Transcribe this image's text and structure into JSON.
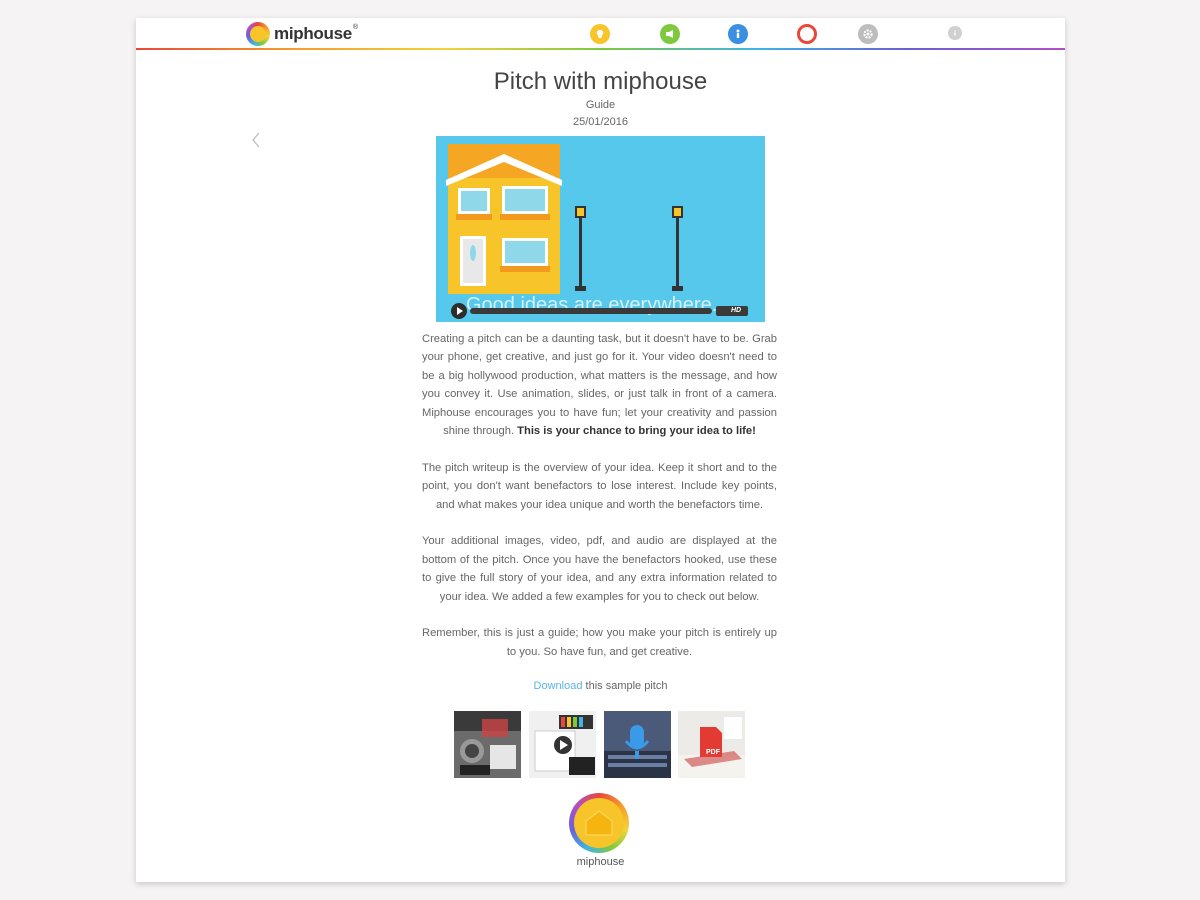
{
  "brand": {
    "name": "miphouse",
    "mark": "®"
  },
  "nav": [
    {
      "name": "ideas-icon",
      "color": "#f7c52a"
    },
    {
      "name": "megaphone-icon",
      "color": "#7fc93f"
    },
    {
      "name": "info-person-icon",
      "color": "#3a8fe0"
    },
    {
      "name": "record-icon",
      "color": "#e8483c"
    },
    {
      "name": "gear-icon",
      "color": "#bdbdbd"
    },
    {
      "name": "info-icon",
      "color": "#d0d0d0"
    }
  ],
  "page": {
    "title": "Pitch with miphouse",
    "subtitle": "Guide",
    "date": "25/01/2016"
  },
  "video": {
    "caption": "Good ideas are everywhere.",
    "quality": "HD"
  },
  "body": {
    "p1": "Creating a pitch can be a daunting task, but it doesn't have to be. Grab your phone, get creative, and just go for it. Your video doesn't need to be a big hollywood production, what matters is the message, and how you convey it. Use animation, slides, or just talk in front of a camera. Miphouse encourages you to have fun; let your creativity and passion shine through.",
    "p1_bold": "This is your chance to bring your idea to life!",
    "p2": "The pitch writeup is the overview of your idea. Keep it short and to the point, you don't want benefactors to lose interest. Include key points, and what makes your idea unique and worth the benefactors time.",
    "p3": "Your additional images, video, pdf, and audio are displayed at the bottom of the pitch. Once you have the benefactors hooked, use these to give the full story of your idea, and any extra information related to your idea. We added a few examples for you to check out below.",
    "p4": "Remember, this is just a guide; how you make your pitch is entirely up to you. So have fun, and get creative."
  },
  "download": {
    "link": "Download",
    "rest": " this sample pitch"
  },
  "attachments": {
    "pdf_label": "PDF"
  },
  "footer": {
    "label": "miphouse"
  }
}
